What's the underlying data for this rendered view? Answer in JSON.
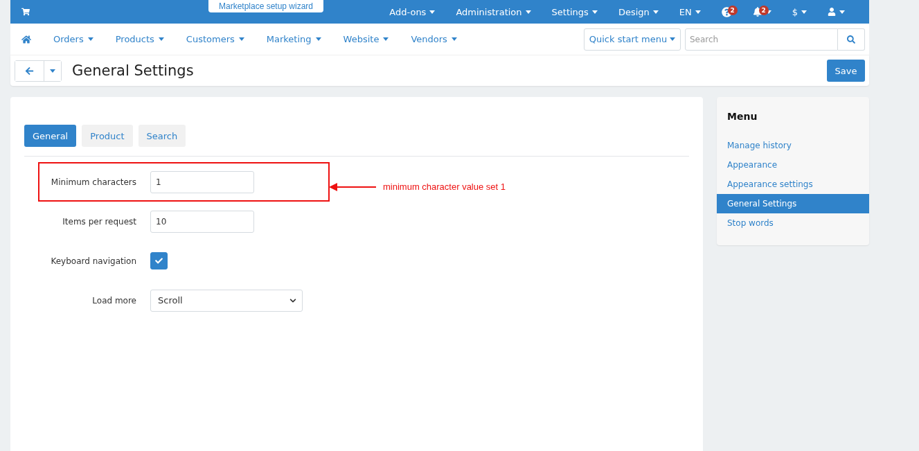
{
  "top_bar": {
    "wizard_button": "Marketplace setup wizard",
    "items": [
      {
        "kind": "text",
        "label": "Add-ons",
        "caret": true
      },
      {
        "kind": "text",
        "label": "Administration",
        "caret": true
      },
      {
        "kind": "text",
        "label": "Settings",
        "caret": true
      },
      {
        "kind": "text",
        "label": "Design",
        "caret": true
      },
      {
        "kind": "text",
        "label": "EN",
        "caret": true
      },
      {
        "kind": "help",
        "badge": "2",
        "caret": false
      },
      {
        "kind": "bell",
        "badge": "2",
        "caret": true
      },
      {
        "kind": "text",
        "label": "$",
        "caret": true
      },
      {
        "kind": "user",
        "caret": true
      }
    ]
  },
  "nav": {
    "items": [
      "Orders",
      "Products",
      "Customers",
      "Marketing",
      "Website",
      "Vendors"
    ],
    "quick_start": "Quick start menu",
    "search": {
      "placeholder": "Search"
    }
  },
  "header": {
    "title": "General Settings",
    "save": "Save"
  },
  "tabs": [
    {
      "label": "General",
      "selected": true
    },
    {
      "label": "Product",
      "selected": false
    },
    {
      "label": "Search",
      "selected": false
    }
  ],
  "fields": [
    {
      "kind": "input",
      "label": "Minimum characters",
      "value": "1",
      "highlighted": true
    },
    {
      "kind": "input",
      "label": "Items per request",
      "value": "10",
      "highlighted": false
    },
    {
      "kind": "checkbox",
      "label": "Keyboard navigation",
      "checked": true,
      "highlighted": false
    },
    {
      "kind": "select",
      "label": "Load more",
      "value": "Scroll",
      "highlighted": false
    }
  ],
  "annotation": "minimum character value set 1",
  "sidebar": {
    "title": "Menu",
    "items": [
      {
        "label": "Manage history",
        "selected": false
      },
      {
        "label": "Appearance",
        "selected": false
      },
      {
        "label": "Appearance settings",
        "selected": false
      },
      {
        "label": "General Settings",
        "selected": true
      },
      {
        "label": "Stop words",
        "selected": false
      }
    ]
  }
}
